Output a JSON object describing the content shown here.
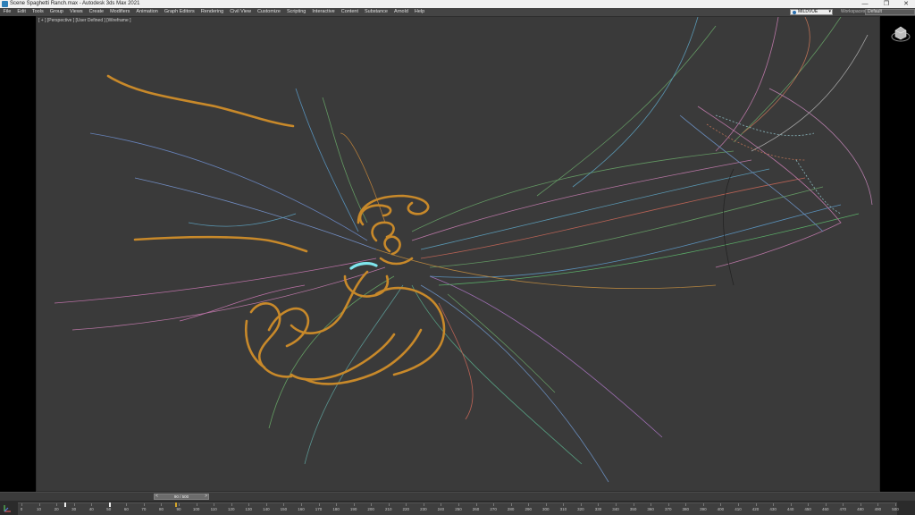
{
  "window": {
    "title": "Scene Spaghetti Ranch.max - Autodesk 3ds Max 2021",
    "controls": [
      "—",
      "❐",
      "✕"
    ]
  },
  "menu": [
    "File",
    "Edit",
    "Tools",
    "Group",
    "Views",
    "Create",
    "Modifiers",
    "Animation",
    "Graph Editors",
    "Rendering",
    "Civil View",
    "Customize",
    "Scripting",
    "Interactive",
    "Content",
    "Substance",
    "Arnold",
    "Help"
  ],
  "user": {
    "name": "MILDVUE",
    "dropdown": "▾"
  },
  "workspace": {
    "label": "Workspaces:",
    "value": "Default"
  },
  "viewport": {
    "label": "[ + ] [Perspective ] [User Defined ] [Wireframe ]",
    "background": "#3a3a3a"
  },
  "timeline": {
    "current": "90 / 500",
    "prev": "<",
    "next": ">",
    "ruler": [
      "0",
      "10",
      "20",
      "30",
      "40",
      "50",
      "60",
      "70",
      "80",
      "90",
      "100",
      "110",
      "120",
      "130",
      "140",
      "150",
      "160",
      "170",
      "180",
      "190",
      "200",
      "210",
      "220",
      "230",
      "240",
      "250",
      "260",
      "270",
      "280",
      "290",
      "300",
      "310",
      "320",
      "330",
      "340",
      "350",
      "360",
      "370",
      "380",
      "390",
      "400",
      "410",
      "420",
      "430",
      "440",
      "450",
      "460",
      "470",
      "480",
      "490",
      "500"
    ]
  },
  "colors": {
    "curve_main": "#c8892a",
    "curve_highlight": "#7fe6ee",
    "slider_key": "#d4a52a"
  }
}
